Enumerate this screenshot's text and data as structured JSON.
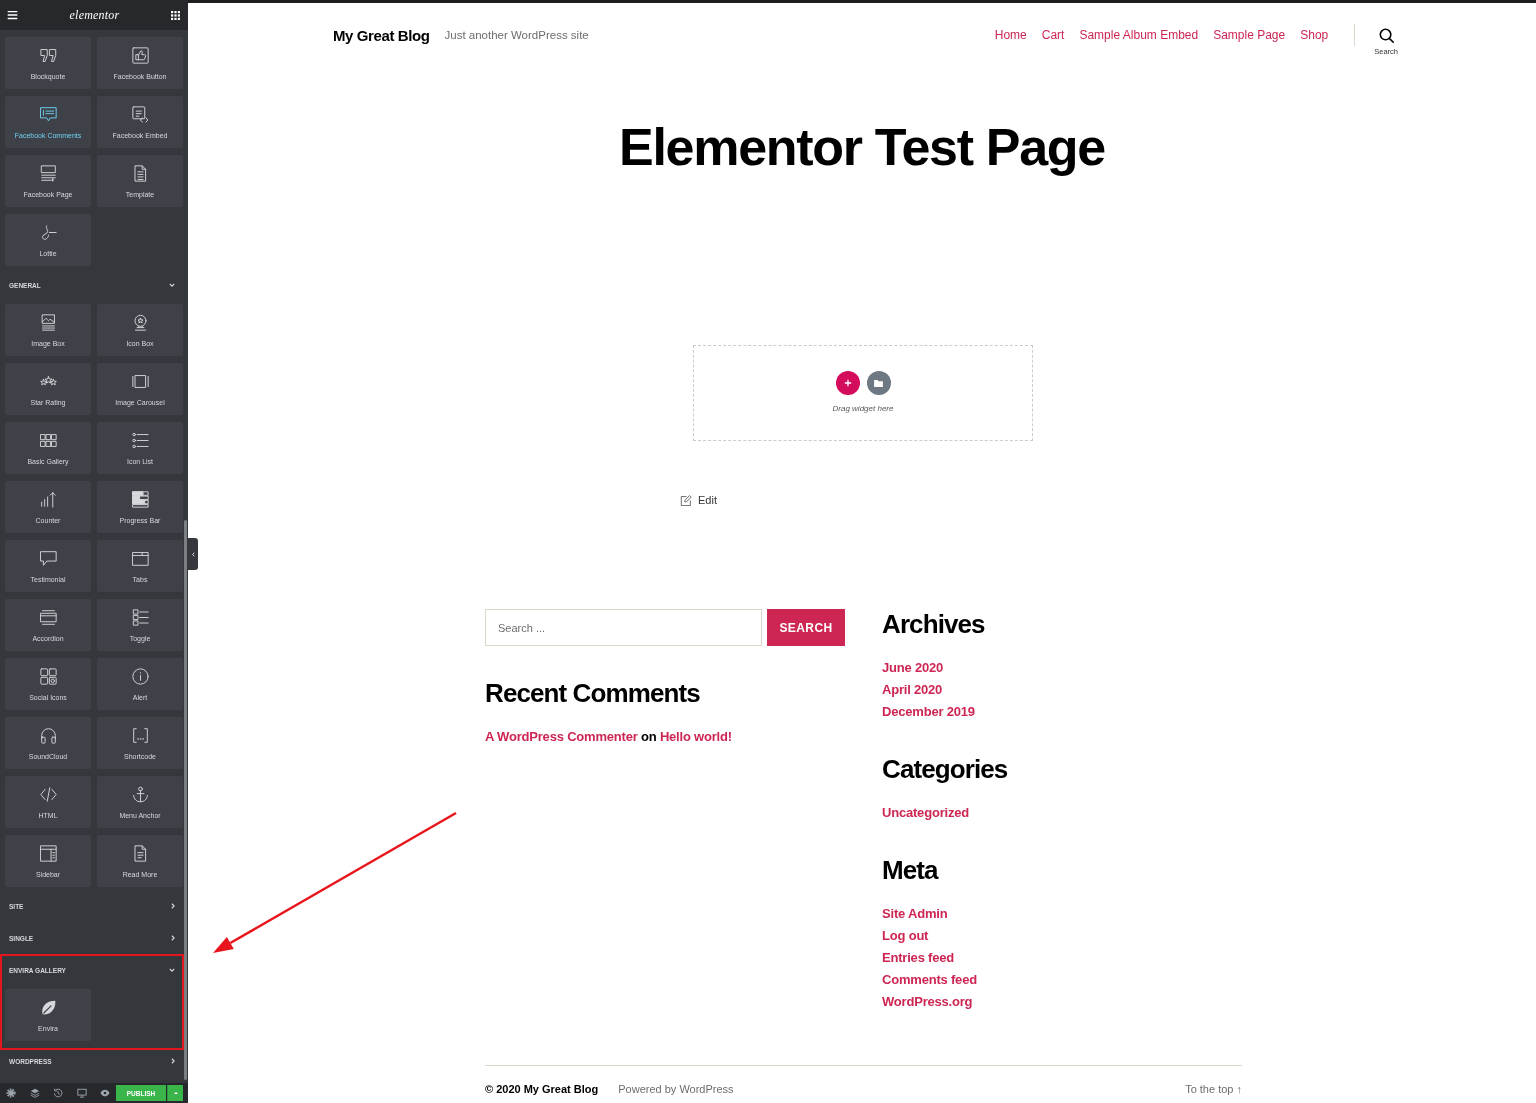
{
  "editor_panel": {
    "header": {
      "logo": "elementor"
    },
    "partial_group": {
      "widgets": [
        {
          "label": "Blockquote",
          "selected": false
        },
        {
          "label": "Facebook Button",
          "selected": false
        },
        {
          "label": "Facebook Comments",
          "selected": true
        },
        {
          "label": "Facebook Embed",
          "selected": false
        },
        {
          "label": "Facebook Page",
          "selected": false
        },
        {
          "label": "Template",
          "selected": false
        },
        {
          "label": "Lottie",
          "selected": false
        }
      ]
    },
    "categories": [
      {
        "name": "GENERAL",
        "expanded": true,
        "highlighted": false,
        "widgets": [
          {
            "label": "Image Box",
            "selected": false
          },
          {
            "label": "Icon Box",
            "selected": false
          },
          {
            "label": "Star Rating",
            "selected": false
          },
          {
            "label": "Image Carousel",
            "selected": false
          },
          {
            "label": "Basic Gallery",
            "selected": false
          },
          {
            "label": "Icon List",
            "selected": false
          },
          {
            "label": "Counter",
            "selected": false
          },
          {
            "label": "Progress Bar",
            "selected": false
          },
          {
            "label": "Testimonial",
            "selected": false
          },
          {
            "label": "Tabs",
            "selected": false
          },
          {
            "label": "Accordion",
            "selected": false
          },
          {
            "label": "Toggle",
            "selected": false
          },
          {
            "label": "Social Icons",
            "selected": false
          },
          {
            "label": "Alert",
            "selected": false
          },
          {
            "label": "SoundCloud",
            "selected": false
          },
          {
            "label": "Shortcode",
            "selected": false
          },
          {
            "label": "HTML",
            "selected": false
          },
          {
            "label": "Menu Anchor",
            "selected": false
          },
          {
            "label": "Sidebar",
            "selected": false
          },
          {
            "label": "Read More",
            "selected": false
          }
        ]
      },
      {
        "name": "SITE",
        "expanded": false,
        "highlighted": false
      },
      {
        "name": "SINGLE",
        "expanded": false,
        "highlighted": false
      },
      {
        "name": "ENVIRA GALLERY",
        "expanded": true,
        "highlighted": true,
        "widgets": [
          {
            "label": "Envira",
            "selected": false
          }
        ]
      },
      {
        "name": "WORDPRESS",
        "expanded": false,
        "highlighted": false
      }
    ],
    "footer": {
      "publish_label": "PUBLISH"
    }
  },
  "site": {
    "header": {
      "title": "My Great Blog",
      "tagline": "Just another WordPress site",
      "nav": [
        "Home",
        "Cart",
        "Sample Album Embed",
        "Sample Page",
        "Shop"
      ],
      "search_label": "Search"
    },
    "page_title": "Elementor Test Page",
    "drop_zone": {
      "hint": "Drag widget here"
    },
    "edit_link": "Edit",
    "search_form": {
      "placeholder": "Search ...",
      "button": "SEARCH"
    },
    "recent_comments": {
      "title": "Recent Comments",
      "items": [
        {
          "author": "A WordPress Commenter",
          "connector": "on",
          "post": "Hello world!"
        }
      ]
    },
    "link_lists": [
      {
        "title": "Archives",
        "links": [
          "June 2020",
          "April 2020",
          "December 2019"
        ]
      },
      {
        "title": "Categories",
        "links": [
          "Uncategorized"
        ]
      },
      {
        "title": "Meta",
        "links": [
          "Site Admin",
          "Log out",
          "Entries feed",
          "Comments feed",
          "WordPress.org"
        ]
      }
    ],
    "footer": {
      "copyright": "© 2020 My Great Blog",
      "credit": "Powered by WordPress",
      "back_to_top": "To the top ↑"
    }
  },
  "annotations": [
    {
      "kind": "arrow"
    }
  ]
}
